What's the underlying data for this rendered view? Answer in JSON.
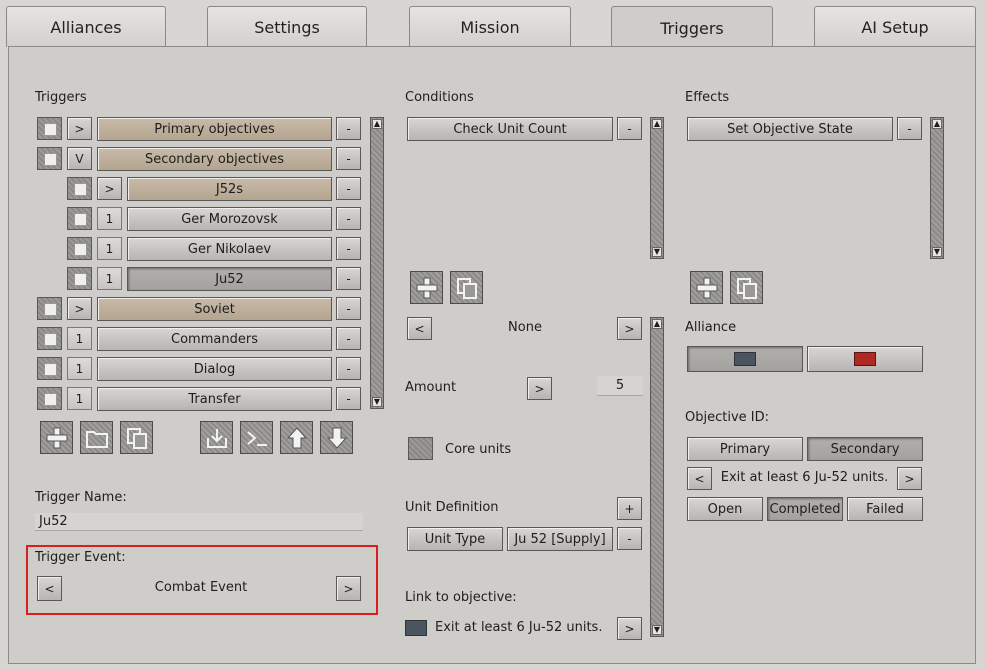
{
  "tabs": [
    "Alliances",
    "Settings",
    "Mission",
    "Triggers",
    "AI Setup"
  ],
  "triggers": {
    "heading": "Triggers",
    "rows": [
      {
        "toggle": ">",
        "label": "Primary objectives",
        "remove": "-"
      },
      {
        "toggle": "V",
        "label": "Secondary objectives",
        "remove": "-"
      },
      {
        "toggle": ">",
        "label": "J52s",
        "remove": "-"
      },
      {
        "toggle": "1",
        "label": "Ger Morozovsk",
        "remove": "-"
      },
      {
        "toggle": "1",
        "label": "Ger Nikolaev",
        "remove": "-"
      },
      {
        "toggle": "1",
        "label": "Ju52",
        "remove": "-"
      },
      {
        "toggle": ">",
        "label": "Soviet",
        "remove": "-"
      },
      {
        "toggle": "1",
        "label": "Commanders",
        "remove": "-"
      },
      {
        "toggle": "1",
        "label": "Dialog",
        "remove": "-"
      },
      {
        "toggle": "1",
        "label": "Transfer",
        "remove": "-"
      }
    ],
    "toolbar_icons": [
      "add-icon",
      "folder-icon",
      "copy-icon",
      "import-icon",
      "script-icon",
      "move-up-icon",
      "move-down-icon"
    ],
    "name_label": "Trigger Name:",
    "name_value": "Ju52",
    "event_label": "Trigger Event:",
    "event_value": "Combat Event",
    "event_prev": "<",
    "event_next": ">"
  },
  "conditions": {
    "heading": "Conditions",
    "item": "Check Unit Count",
    "remove": "-",
    "selector_prev": "<",
    "selector_value": "None",
    "selector_next": ">",
    "amount_label": "Amount",
    "amount_button": ">",
    "amount_value": "5",
    "core_units_label": "Core units",
    "unit_definition_label": "Unit Definition",
    "unit_definition_add": "+",
    "unit_type_label": "Unit Type",
    "unit_type_value": "Ju 52 [Supply]",
    "unit_type_remove": "-",
    "link_label": "Link to objective:",
    "link_value": "Exit at least 6 Ju-52 units.",
    "link_button": ">"
  },
  "effects": {
    "heading": "Effects",
    "item": "Set Objective State",
    "remove": "-",
    "alliance_label": "Alliance",
    "alliance_colors": [
      "#4b5560",
      "#b02a24"
    ],
    "objective_id_label": "Objective ID:",
    "objective_tabs": [
      "Primary",
      "Secondary"
    ],
    "objective_prev": "<",
    "objective_value": "Exit at least 6 Ju-52 units.",
    "objective_next": ">",
    "states": [
      "Open",
      "Completed",
      "Failed"
    ]
  },
  "colors": {
    "highlight": "#d81e1e",
    "warm_button": "#c0b39f"
  }
}
